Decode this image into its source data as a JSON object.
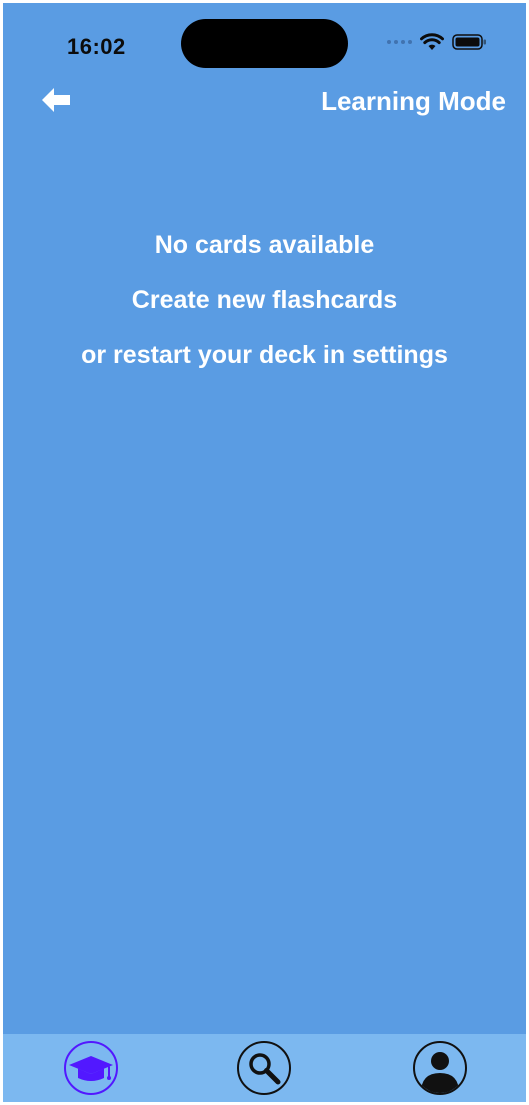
{
  "status_bar": {
    "time": "16:02",
    "icons": [
      "signal-dots-icon",
      "wifi-icon",
      "battery-icon"
    ]
  },
  "header": {
    "back_icon": "back-arrow-icon",
    "title": "Learning Mode"
  },
  "empty_state": {
    "line1": "No cards available",
    "line2": "Create new flashcards",
    "line3": "or restart your deck in settings"
  },
  "tab_bar": {
    "tabs": [
      {
        "icon": "graduation-cap-icon",
        "selected": true
      },
      {
        "icon": "magnifier-icon",
        "selected": false
      },
      {
        "icon": "profile-icon",
        "selected": false
      }
    ]
  },
  "colors": {
    "background": "#5a9ce3",
    "tab_bar": "#7cb8f0",
    "active_tab": "#5218ff",
    "text": "#ffffff"
  }
}
